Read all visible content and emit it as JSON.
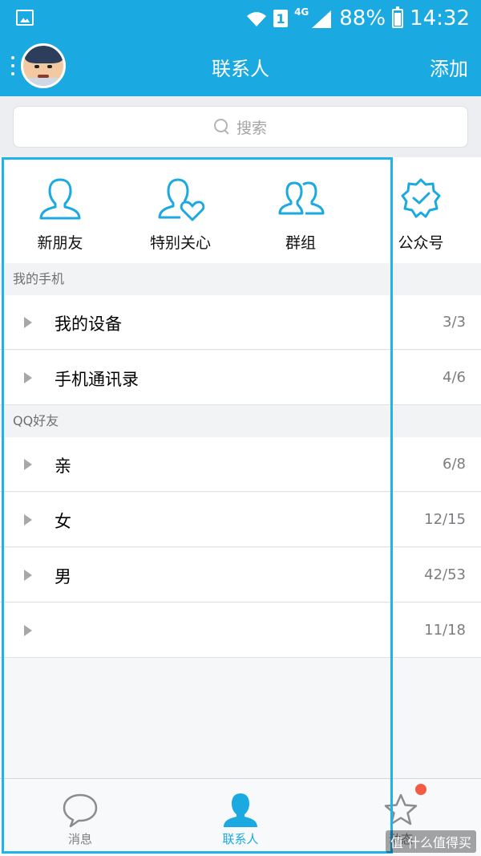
{
  "status_bar": {
    "sim": "1",
    "network": "4G",
    "battery": "88%",
    "time": "14:32"
  },
  "header": {
    "title": "联系人",
    "add_label": "添加"
  },
  "search": {
    "placeholder": "搜索"
  },
  "quick_actions": [
    {
      "label": "新朋友",
      "icon": "person-icon"
    },
    {
      "label": "特别关心",
      "icon": "person-heart-icon"
    },
    {
      "label": "群组",
      "icon": "group-icon"
    },
    {
      "label": "公众号",
      "icon": "verified-badge-icon"
    }
  ],
  "sections": [
    {
      "title": "我的手机",
      "groups": [
        {
          "label": "我的设备",
          "count": "3/3"
        },
        {
          "label": "手机通讯录",
          "count": "4/6"
        }
      ]
    },
    {
      "title": "QQ好友",
      "groups": [
        {
          "label": "亲",
          "count": "6/8"
        },
        {
          "label": "女",
          "count": "12/15"
        },
        {
          "label": "男",
          "count": "42/53"
        },
        {
          "label": "",
          "count": "11/18"
        }
      ]
    }
  ],
  "tabs": [
    {
      "label": "消息",
      "icon": "chat-bubble-icon"
    },
    {
      "label": "联系人",
      "icon": "contacts-icon"
    },
    {
      "label": "动态",
      "icon": "star-icon"
    }
  ],
  "colors": {
    "brand": "#1aa9e1",
    "highlight_border": "#1fb3e8",
    "badge_red": "#f45b43"
  },
  "watermark": "值 什么值得买"
}
